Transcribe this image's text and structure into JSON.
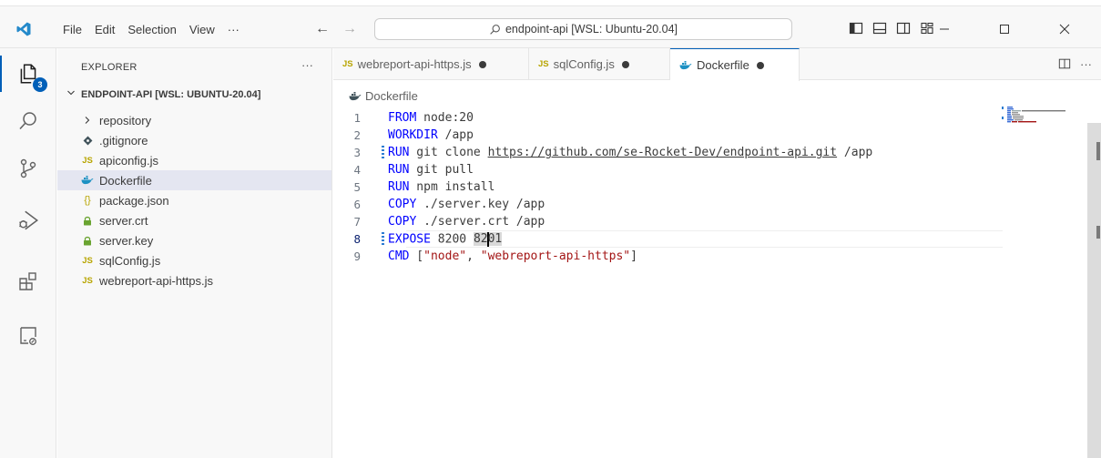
{
  "title_bar": {
    "menu": [
      "File",
      "Edit",
      "Selection",
      "View",
      "···"
    ],
    "search_text": "endpoint-api [WSL: Ubuntu-20.04]"
  },
  "activity_bar": {
    "items": [
      "explorer-icon",
      "search-icon",
      "source-control-icon",
      "run-debug-icon",
      "extensions-icon",
      "remote-explorer-icon"
    ],
    "explorer_badge": "3"
  },
  "sidebar": {
    "header": "EXPLORER",
    "more": "···",
    "root": "ENDPOINT-API [WSL: UBUNTU-20.04]",
    "items": [
      {
        "label": "repository",
        "icon": "chevron-right-icon",
        "glyph": "›"
      },
      {
        "label": ".gitignore",
        "icon": "git-icon",
        "glyph": "◆"
      },
      {
        "label": "apiconfig.js",
        "icon": "js-icon",
        "glyph": "JS"
      },
      {
        "label": "Dockerfile",
        "icon": "docker-icon",
        "glyph": ""
      },
      {
        "label": "package.json",
        "icon": "json-icon",
        "glyph": "{}"
      },
      {
        "label": "server.crt",
        "icon": "lock-icon",
        "glyph": ""
      },
      {
        "label": "server.key",
        "icon": "lock-icon",
        "glyph": ""
      },
      {
        "label": "sqlConfig.js",
        "icon": "js-icon",
        "glyph": "JS"
      },
      {
        "label": "webreport-api-https.js",
        "icon": "js-icon",
        "glyph": "JS"
      }
    ],
    "selected_index": 3
  },
  "tabs": [
    {
      "label": "webreport-api-https.js",
      "icon": "js-icon",
      "modified": true
    },
    {
      "label": "sqlConfig.js",
      "icon": "js-icon",
      "modified": true
    },
    {
      "label": "Dockerfile",
      "icon": "docker-icon",
      "modified": true,
      "active": true
    }
  ],
  "tab_actions": {
    "split": "split-editor-icon",
    "more": "···"
  },
  "breadcrumb": "Dockerfile",
  "code": {
    "line_numbers": [
      "1",
      "2",
      "3",
      "4",
      "5",
      "6",
      "7",
      "8",
      "9"
    ],
    "lines": [
      {
        "kw": "FROM",
        "rest": " node:20"
      },
      {
        "kw": "WORKDIR",
        "rest": " /app"
      },
      {
        "kw": "RUN",
        "rest": " git clone ",
        "url": "https://github.com/se-Rocket-Dev/endpoint-api.git",
        "tail": " /app"
      },
      {
        "kw": "RUN",
        "rest": " git pull"
      },
      {
        "kw": "RUN",
        "rest": " npm install"
      },
      {
        "kw": "COPY",
        "rest": " ./server.key /app"
      },
      {
        "kw": "COPY",
        "rest": " ./server.crt /app"
      },
      {
        "kw": "EXPOSE",
        "rest": " 8200 ",
        "sel_a": "82",
        "sel_b": "01"
      },
      {
        "kw": "CMD",
        "rest": " [",
        "s1": "\"node\"",
        "mid": ", ",
        "s2": "\"webreport-api-https\"",
        "tail": "]"
      }
    ],
    "modified_lines": [
      "3",
      "8"
    ],
    "current_line": "8"
  },
  "colors": {
    "accent": "#005fb8",
    "keyword": "#0000ff",
    "string": "#a31515"
  }
}
